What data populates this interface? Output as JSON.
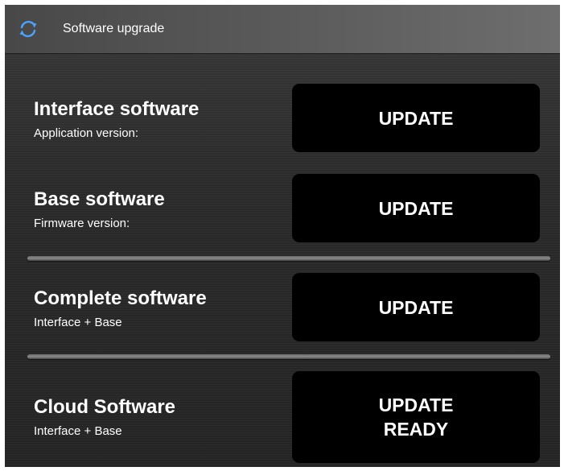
{
  "header": {
    "title": "Software upgrade",
    "icon": "sync-icon",
    "icon_color": "#4aa3ff"
  },
  "rows": [
    {
      "title": "Interface software",
      "subtitle": "Application version:",
      "button_label": "UPDATE"
    },
    {
      "title": "Base software",
      "subtitle": "Firmware version:",
      "button_label": "UPDATE"
    },
    {
      "title": "Complete software",
      "subtitle": "Interface + Base",
      "button_label": "UPDATE"
    },
    {
      "title": "Cloud Software",
      "subtitle": "Interface + Base",
      "button_label_line1": "UPDATE",
      "button_label_line2": "READY"
    }
  ]
}
